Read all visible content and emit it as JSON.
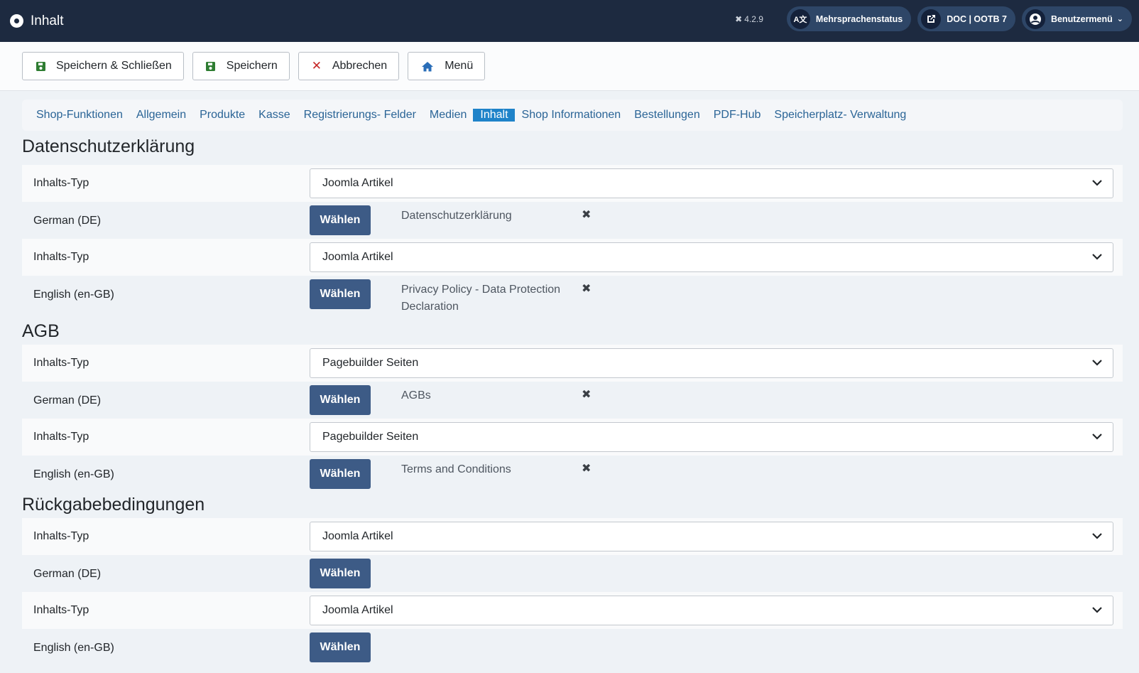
{
  "header": {
    "title": "Inhalt",
    "version": "4.2.9",
    "multilang_status": "Mehrsprachenstatus",
    "site_link": "DOC | OOTB 7",
    "user_menu": "Benutzermenü"
  },
  "toolbar": {
    "save_close": "Speichern & Schließen",
    "save": "Speichern",
    "cancel": "Abbrechen",
    "menu": "Menü"
  },
  "tabs": [
    "Shop-Funktionen",
    "Allgemein",
    "Produkte",
    "Kasse",
    "Registrierungs- Felder",
    "Medien",
    "Inhalt",
    "Shop Informationen",
    "Bestellungen",
    "PDF-Hub",
    "Speicherplatz- Verwaltung"
  ],
  "active_tab": "Inhalt",
  "choose_label": "Wählen",
  "sections": [
    {
      "title": "Datenschutzerklärung",
      "rows": [
        {
          "type_label": "Inhalts-Typ",
          "type_value": "Joomla Artikel",
          "lang_label": "German (DE)",
          "selected": "Datenschutzerklärung"
        },
        {
          "type_label": "Inhalts-Typ",
          "type_value": "Joomla Artikel",
          "lang_label": "English (en-GB)",
          "selected": "Privacy Policy - Data Protection Declaration"
        }
      ]
    },
    {
      "title": "AGB",
      "rows": [
        {
          "type_label": "Inhalts-Typ",
          "type_value": "Pagebuilder Seiten",
          "lang_label": "German (DE)",
          "selected": "AGBs"
        },
        {
          "type_label": "Inhalts-Typ",
          "type_value": "Pagebuilder Seiten",
          "lang_label": "English (en-GB)",
          "selected": "Terms and Conditions"
        }
      ]
    },
    {
      "title": "Rückgabebedingungen",
      "rows": [
        {
          "type_label": "Inhalts-Typ",
          "type_value": "Joomla Artikel",
          "lang_label": "German (DE)",
          "selected": ""
        },
        {
          "type_label": "Inhalts-Typ",
          "type_value": "Joomla Artikel",
          "lang_label": "English (en-GB)",
          "selected": ""
        }
      ]
    }
  ],
  "colors": {
    "header_bg": "#1d2a40",
    "accent": "#1f83c9",
    "button": "#3d5b86",
    "link": "#2a6496"
  }
}
